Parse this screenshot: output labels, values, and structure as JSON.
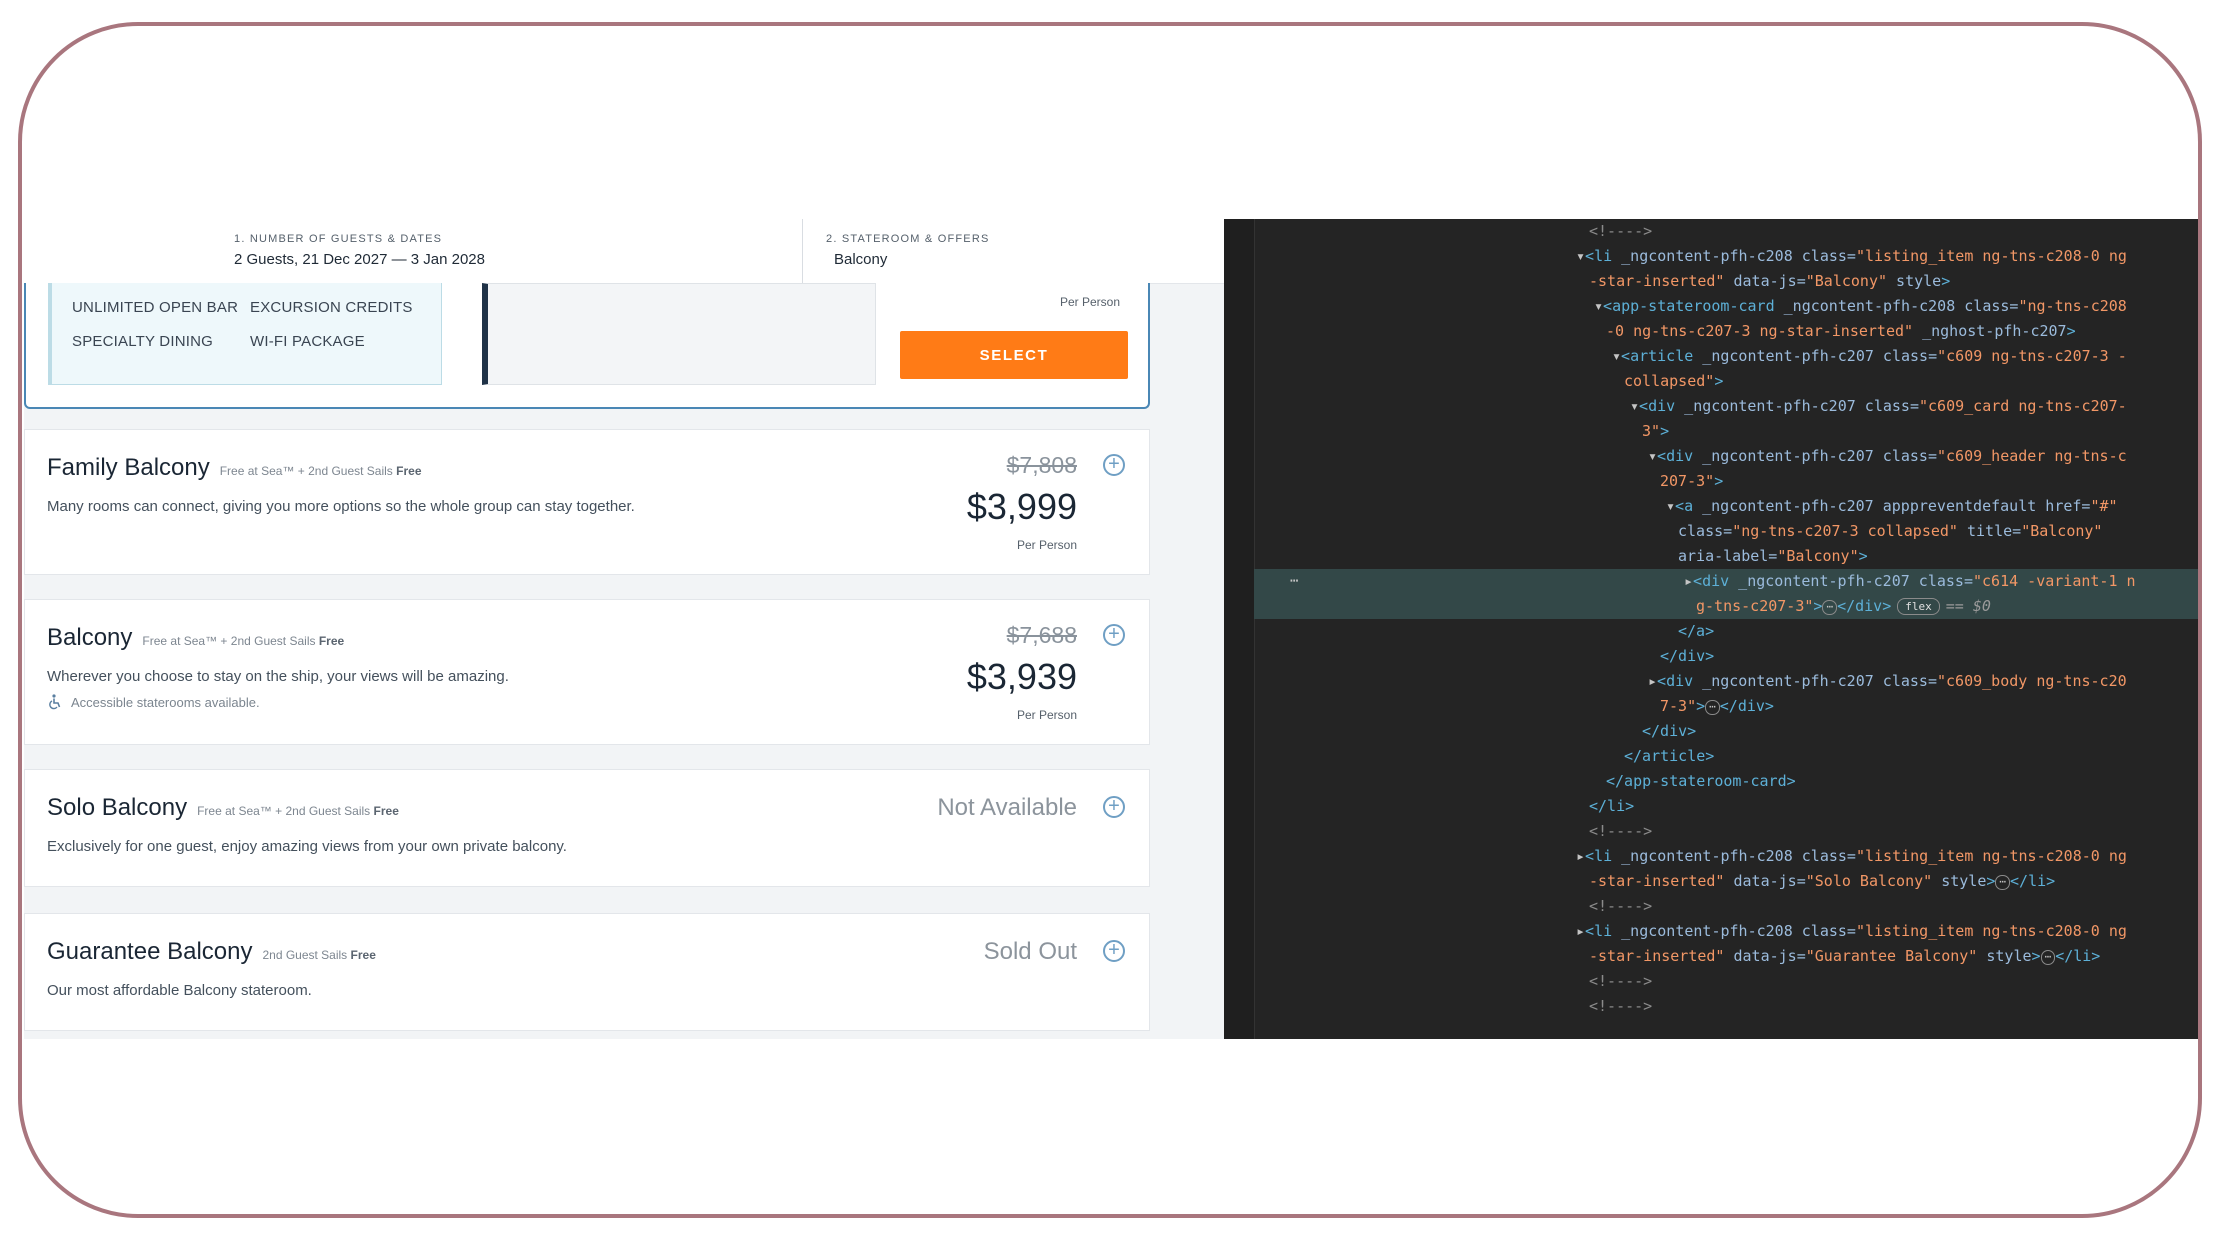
{
  "steps": [
    {
      "label": "1. Number of guests & dates",
      "value": "2 Guests,  21 Dec 2027 — 3 Jan 2028"
    },
    {
      "label": "2. Stateroom & offers",
      "value": "Balcony"
    }
  ],
  "open_card": {
    "perks": [
      "UNLIMITED OPEN BAR",
      "EXCURSION CREDITS",
      "SPECIALTY DINING",
      "WI-FI PACKAGE"
    ],
    "per_person": "Per Person",
    "select_label": "SELECT"
  },
  "cards": [
    {
      "title": "Family Balcony",
      "promo_text": "Free at Sea™ + 2nd Guest Sails ",
      "promo_bold": "Free",
      "description": "Many rooms can connect, giving you more options so the whole group can stay together.",
      "old_price": "$7,808",
      "price": "$3,999",
      "per_person": "Per Person"
    },
    {
      "title": "Balcony",
      "promo_text": "Free at Sea™ + 2nd Guest Sails ",
      "promo_bold": "Free",
      "description": "Wherever you choose to stay on the ship, your views will be amazing.",
      "accessible": "Accessible staterooms available.",
      "old_price": "$7,688",
      "price": "$3,939",
      "per_person": "Per Person"
    },
    {
      "title": "Solo Balcony",
      "promo_text": "Free at Sea™ + 2nd Guest Sails ",
      "promo_bold": "Free",
      "description": "Exclusively for one guest, enjoy amazing views from your own private balcony.",
      "status": "Not Available"
    },
    {
      "title": "Guarantee Balcony",
      "promo_text": "2nd Guest Sails ",
      "promo_bold": "Free",
      "description": "Our most affordable Balcony stateroom.",
      "status": "Sold Out"
    }
  ],
  "devtools": {
    "comment": "<!---->",
    "l1": {
      "tag": "li",
      "attr1": " _ngcontent-pfh-c208 class=",
      "class": "\"listing_item ng-tns-c208-0 ng",
      "cont": "-star-inserted\"",
      "attr2": " data-js=",
      "datajs": "\"Balcony\"",
      "attr3": " style",
      "end": ">"
    },
    "l2": {
      "tag": "app-stateroom-card",
      "attr1": " _ngcontent-pfh-c208 class=",
      "class": "\"ng-tns-c208",
      "cont": "-0 ng-tns-c207-3 ng-star-inserted\"",
      "attr2": " _nghost-pfh-c207",
      "end": ">"
    },
    "l3": {
      "tag": "article",
      "attr1": " _ngcontent-pfh-c207 class=",
      "class": "\"c609 ng-tns-c207-3 -",
      "cont": "collapsed\"",
      "end": ">"
    },
    "l4": {
      "tag": "div",
      "attr1": " _ngcontent-pfh-c207 class=",
      "class": "\"c609_card ng-tns-c207-",
      "cont": "3\"",
      "end": ">"
    },
    "l5": {
      "tag": "div",
      "attr1": " _ngcontent-pfh-c207 class=",
      "class": "\"c609_header ng-tns-c",
      "cont": "207-3\"",
      "end": ">"
    },
    "l6": {
      "tag": "a",
      "attr1": " _ngcontent-pfh-c207 apppreventdefault href=",
      "href": "\"#\"",
      "attr2": "class=",
      "class": "\"ng-tns-c207-3 collapsed\"",
      "attr3": " title=",
      "title": "\"Balcony\"",
      "attr4": "aria-label=",
      "aria": "\"Balcony\"",
      "end": ">"
    },
    "l7": {
      "tag": "div",
      "attr1": " _ngcontent-pfh-c207 class=",
      "class": "\"c614 -variant-1 n",
      "cont": "g-tns-c207-3\"",
      "ellipsis": "⋯",
      "close": "</div>",
      "badge": "flex",
      "eq": "== $0"
    },
    "close_a": "</a>",
    "close_div": "</div>",
    "l8": {
      "tag": "div",
      "attr1": " _ngcontent-pfh-c207 class=",
      "class": "\"c609_body ng-tns-c20",
      "cont": "7-3\"",
      "ellipsis": "⋯",
      "close": "</div>"
    },
    "close_article": "</article>",
    "close_card": "</app-stateroom-card>",
    "close_li": "</li>",
    "l9": {
      "tag": "li",
      "attr1": " _ngcontent-pfh-c208 class=",
      "class": "\"listing_item ng-tns-c208-0 ng",
      "cont": "-star-inserted\"",
      "attr2": " data-js=",
      "datajs": "\"Solo Balcony\"",
      "attr3": " style",
      "ellipsis": "⋯",
      "close": "</li>"
    },
    "l10": {
      "tag": "li",
      "attr1": " _ngcontent-pfh-c208 class=",
      "class": "\"listing_item ng-tns-c208-0 ng",
      "cont": "-star-inserted\"",
      "attr2": " data-js=",
      "datajs": "\"Guarantee Balcony\"",
      "attr3": " style",
      "ellipsis": "⋯",
      "close": "</li>"
    },
    "dots": "⋯"
  },
  "colors": {
    "accent_orange": "#ff7b16",
    "devtools_bg": "#242424",
    "frame_border": "#a9767e"
  }
}
